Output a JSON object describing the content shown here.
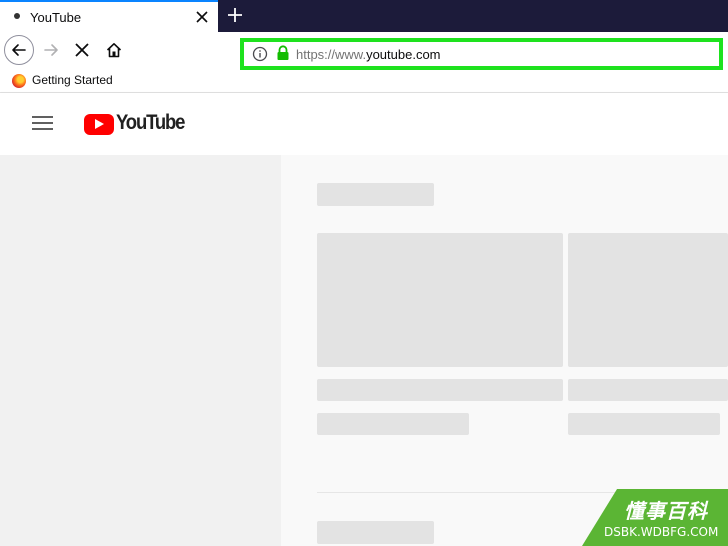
{
  "browser": {
    "tab": {
      "title": "YouTube"
    },
    "address_bar": {
      "url_prefix": "https://www.",
      "url_host": "youtube.com"
    },
    "bookmarks": [
      {
        "label": "Getting Started"
      }
    ],
    "highlight_color": "#1ee21e"
  },
  "youtube": {
    "logo_text": "YouTube",
    "brand_color": "#ff0000"
  },
  "watermark": {
    "chinese": "懂事百科",
    "domain": "DSBK.WDBFG.COM"
  },
  "icons": [
    "tab-favicon",
    "close-icon",
    "plus-icon",
    "back-arrow-icon",
    "forward-arrow-icon",
    "stop-icon",
    "home-icon",
    "info-icon",
    "lock-icon",
    "firefox-icon",
    "hamburger-menu-icon",
    "youtube-play-icon"
  ]
}
